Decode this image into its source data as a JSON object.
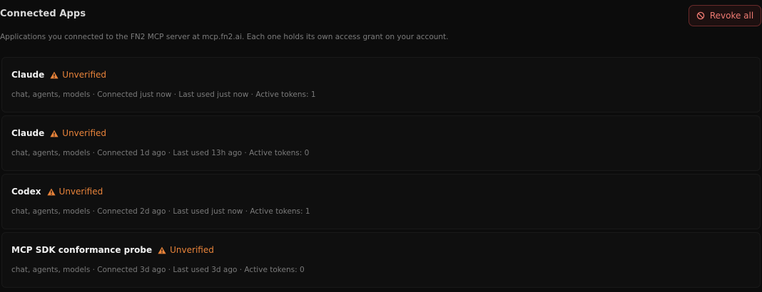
{
  "header": {
    "title": "Connected Apps",
    "subtitle": "Applications you connected to the FN2 MCP server at mcp.fn2.ai. Each one holds its own access grant on your account.",
    "revoke_all_label": "Revoke all",
    "revoke_icon": "ban-icon"
  },
  "colors": {
    "background": "#0c0c0c",
    "warning": "#e8833a",
    "danger": "#ee7a72"
  },
  "apps": [
    {
      "name": "Claude",
      "badge": "Unverified",
      "badge_icon": "warning-icon",
      "meta": "chat, agents, models · Connected just now · Last used just now · Active tokens: 1"
    },
    {
      "name": "Claude",
      "badge": "Unverified",
      "badge_icon": "warning-icon",
      "meta": "chat, agents, models · Connected 1d ago · Last used 13h ago · Active tokens: 0"
    },
    {
      "name": "Codex",
      "badge": "Unverified",
      "badge_icon": "warning-icon",
      "meta": "chat, agents, models · Connected 2d ago · Last used just now · Active tokens: 1"
    },
    {
      "name": "MCP SDK conformance probe",
      "badge": "Unverified",
      "badge_icon": "warning-icon",
      "meta": "chat, agents, models · Connected 3d ago · Last used 3d ago · Active tokens: 0"
    }
  ]
}
